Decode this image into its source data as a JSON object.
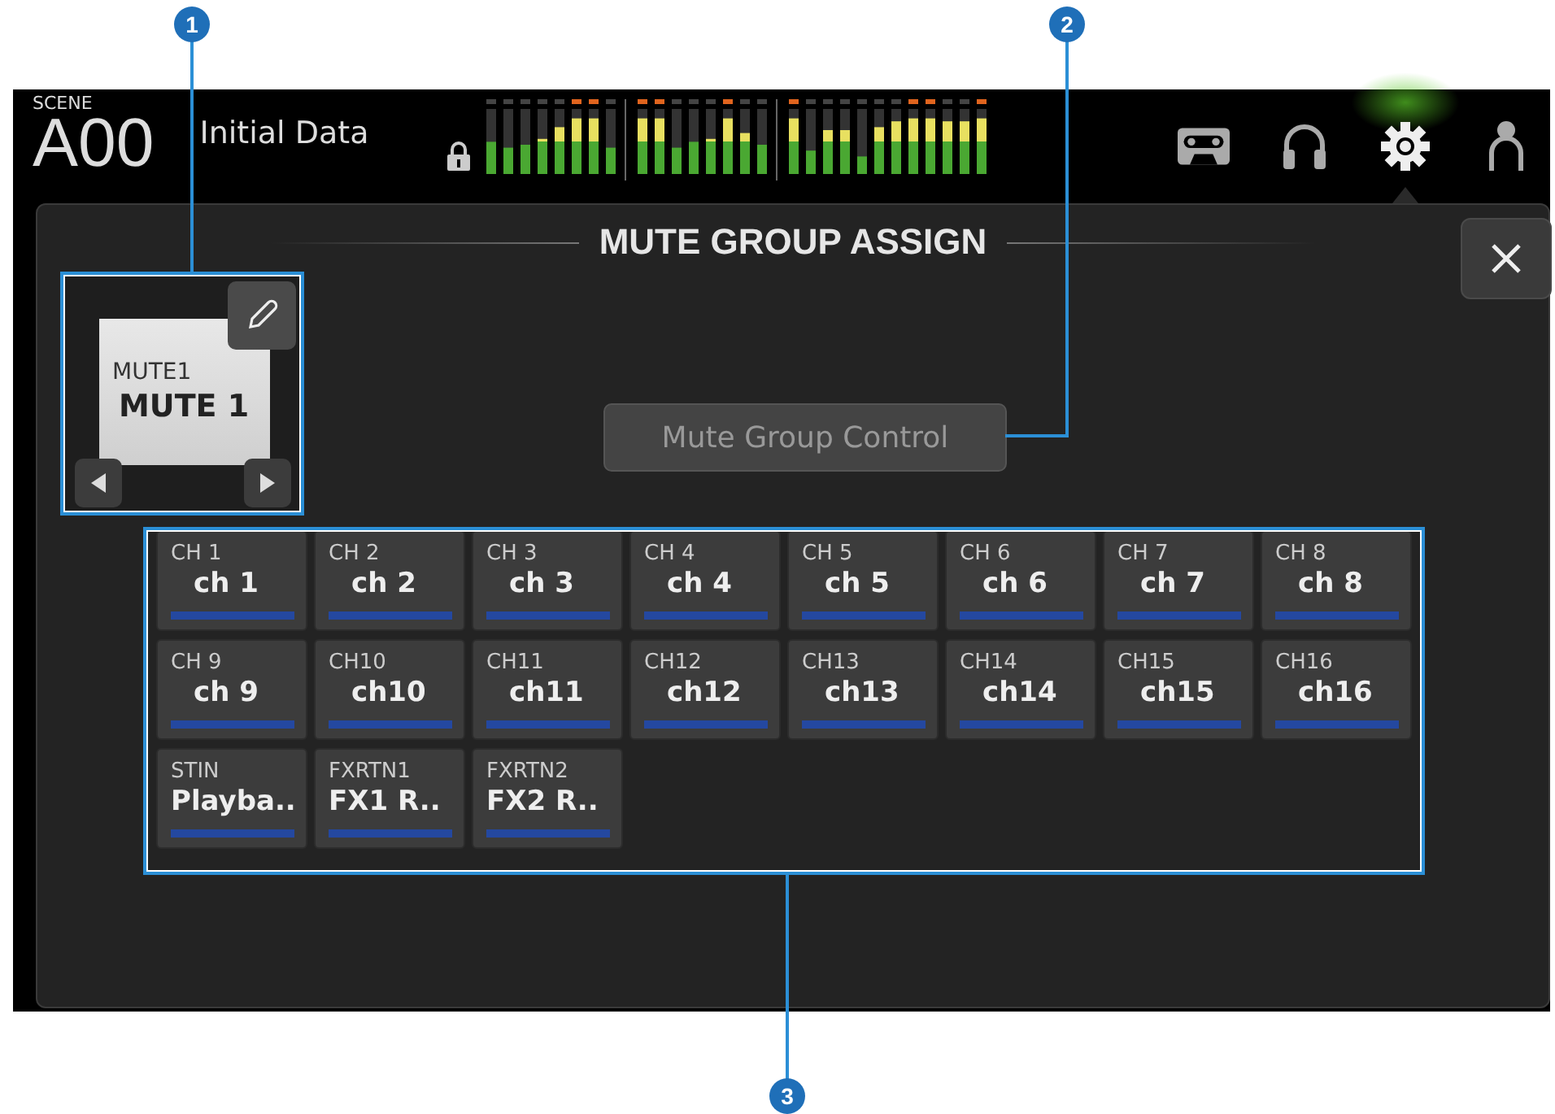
{
  "callouts": [
    {
      "number": "1"
    },
    {
      "number": "2"
    },
    {
      "number": "3"
    }
  ],
  "top_bar": {
    "scene_label": "SCENE",
    "scene_number": "A00",
    "scene_title": "Initial Data",
    "locked": true,
    "toolbar": [
      {
        "kind": "recorder",
        "selected": false
      },
      {
        "kind": "headphones",
        "selected": false
      },
      {
        "kind": "settings",
        "selected": true
      },
      {
        "kind": "user",
        "selected": false
      }
    ]
  },
  "dialog": {
    "title": "MUTE GROUP ASSIGN",
    "mute_group": {
      "label": "MUTE1",
      "name": "MUTE 1"
    },
    "control_button": {
      "label": "Mute Group Control",
      "disabled": true
    },
    "channels": [
      {
        "id": "CH 1",
        "name": "ch 1"
      },
      {
        "id": "CH 2",
        "name": "ch 2"
      },
      {
        "id": "CH 3",
        "name": "ch 3"
      },
      {
        "id": "CH 4",
        "name": "ch 4"
      },
      {
        "id": "CH 5",
        "name": "ch 5"
      },
      {
        "id": "CH 6",
        "name": "ch 6"
      },
      {
        "id": "CH 7",
        "name": "ch 7"
      },
      {
        "id": "CH 8",
        "name": "ch 8"
      },
      {
        "id": "CH 9",
        "name": "ch 9"
      },
      {
        "id": "CH10",
        "name": "ch10"
      },
      {
        "id": "CH11",
        "name": "ch11"
      },
      {
        "id": "CH12",
        "name": "ch12"
      },
      {
        "id": "CH13",
        "name": "ch13"
      },
      {
        "id": "CH14",
        "name": "ch14"
      },
      {
        "id": "CH15",
        "name": "ch15"
      },
      {
        "id": "CH16",
        "name": "ch16"
      },
      {
        "id": "STIN",
        "name": "Playba.."
      },
      {
        "id": "FXRTN1",
        "name": "FX1 R.."
      },
      {
        "id": "FXRTN2",
        "name": "FX2 R.."
      }
    ]
  }
}
